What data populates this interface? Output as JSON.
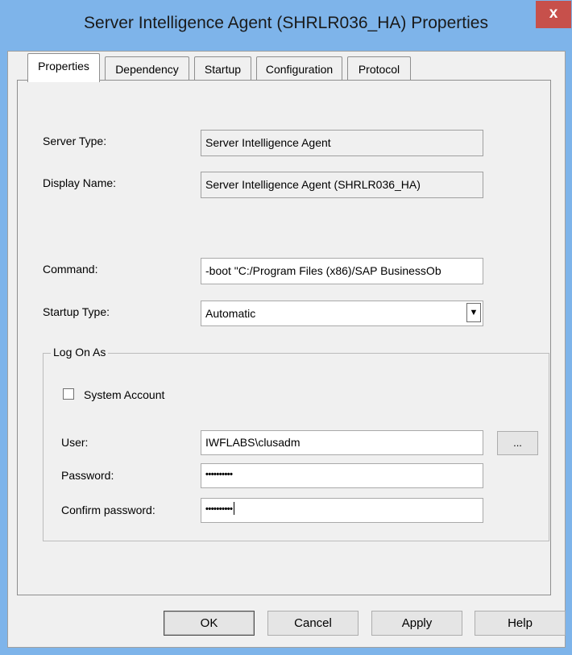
{
  "window": {
    "title": "Server Intelligence Agent (SHRLR036_HA) Properties",
    "close_label": "x"
  },
  "tabs": [
    {
      "label": "Properties",
      "active": true
    },
    {
      "label": "Dependency",
      "active": false
    },
    {
      "label": "Startup",
      "active": false
    },
    {
      "label": "Configuration",
      "active": false
    },
    {
      "label": "Protocol",
      "active": false
    }
  ],
  "properties": {
    "server_type_label": "Server Type:",
    "server_type_value": "Server Intelligence Agent",
    "display_name_label": "Display Name:",
    "display_name_value": "Server Intelligence Agent (SHRLR036_HA)",
    "command_label": "Command:",
    "command_value": "-boot \"C:/Program Files (x86)/SAP BusinessOb",
    "startup_type_label": "Startup Type:",
    "startup_type_value": "Automatic"
  },
  "logon": {
    "group_title": "Log On As",
    "system_account_label": "System Account",
    "system_account_checked": false,
    "user_label": "User:",
    "user_value": "IWFLABS\\clusadm",
    "browse_label": "...",
    "password_label": "Password:",
    "password_mask": "••••••••••",
    "confirm_label": "Confirm password:",
    "confirm_mask": "••••••••••"
  },
  "buttons": {
    "ok": "OK",
    "cancel": "Cancel",
    "apply": "Apply",
    "help": "Help"
  },
  "colors": {
    "titlebar": "#7eb4ea",
    "close_button": "#c7504b",
    "dialog_face": "#f0f0f0"
  }
}
